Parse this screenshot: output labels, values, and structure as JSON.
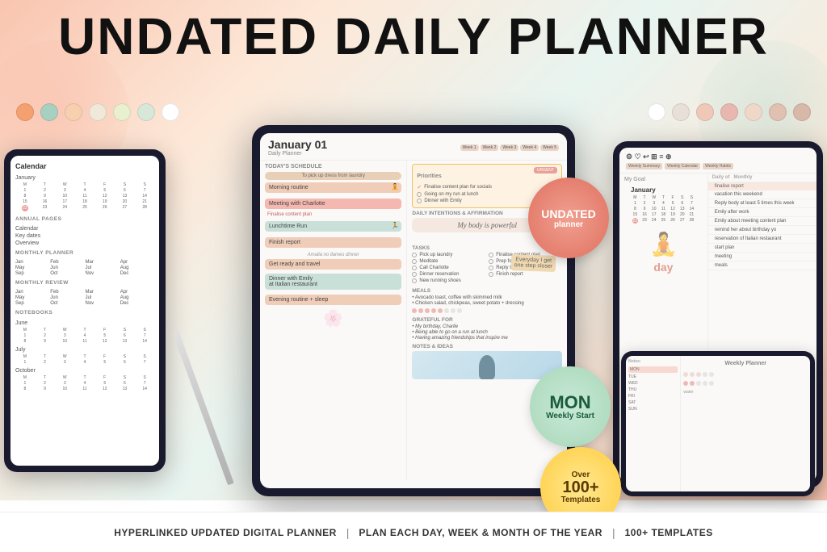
{
  "page": {
    "title": "UNDATED DAILY PLANNER",
    "subtitle": "HYPERLINKED UPDATED DIGITAL PLANNER | PLAN EACH DAY, WEEK & MONTH OF THE YEAR | 100+ TEMPLATES"
  },
  "colors": {
    "peach": "#f9c5b0",
    "teal_light": "#c8e0d8",
    "cream": "#faf9f7",
    "salmon": "#e8a098",
    "gold": "#ffcc40",
    "green_badge": "#a8d8b8",
    "dark_tablet": "#1a1a2e",
    "accent_pink": "#f4b8b0",
    "accent_peach": "#f0cdb8"
  },
  "dots_left": [
    "#f4a070",
    "#a8d0c0",
    "#f8d0b0",
    "#f0e8d8",
    "#e8f0d0",
    "#d8e8d8",
    "#fff"
  ],
  "dots_right": [
    "#fff",
    "#e8e0d8",
    "#f0c8b8",
    "#e8b8b0",
    "#f0d8c8",
    "#e0c0b0",
    "#d8b8a8"
  ],
  "center_tablet": {
    "date": "January 01",
    "subtitle": "Daily Planner",
    "week_buttons": [
      "Week 1",
      "Week 2",
      "Week 3",
      "Week 4",
      "Week 5"
    ],
    "schedule": {
      "label": "Today's Schedule",
      "items": [
        {
          "text": "Morning routine",
          "style": "peach"
        },
        {
          "text": "Meeting with Charlotte",
          "style": "pink"
        },
        {
          "text": "Finalise content plan",
          "sub": true
        },
        {
          "text": "Lunchtime Run",
          "style": "teal"
        },
        {
          "text": "Finish report",
          "style": "peach"
        },
        {
          "text": "Amalia no llames dinner",
          "note": true
        },
        {
          "text": "Get ready and travel",
          "style": "peach"
        },
        {
          "text": "Dinner with Emily at Italian restaurant",
          "style": "teal"
        },
        {
          "text": "Evening routine + sleep",
          "style": "peach"
        }
      ]
    },
    "priorities": {
      "label": "Priorities",
      "urgent_badge": "URGENT",
      "items": [
        "Finalise content plan for socials",
        "Going on my run at lunch",
        "Dinner with Emily"
      ]
    },
    "intentions": {
      "label": "Daily Intentions & Affirmation",
      "text": "My body is powerful",
      "sticky": "Everyday I get one step closer"
    },
    "tasks": {
      "label": "Tasks",
      "left": [
        "Pick up laundry",
        "Meditate",
        "Call Charlotte",
        "Dinner reservation",
        "New running shoes"
      ],
      "right": [
        "Finalise content plan",
        "Prep for meeting",
        "Reply to emails",
        "Finish report"
      ]
    },
    "meals": {
      "label": "Meals",
      "items": [
        "Avocado toast, coffee with skimmed milk",
        "Chicken salad, chickpeas, sweet potato + dressing"
      ],
      "tracker": [
        true,
        true,
        true,
        true,
        true,
        false,
        false,
        false
      ]
    },
    "grateful": {
      "label": "Grateful for",
      "items": [
        "My birthday, Charlie",
        "Being able to go on a run at lunch",
        "Having amazing friendships that inspire me"
      ]
    },
    "notes": {
      "label": "Notes & Ideas"
    }
  },
  "left_tablet": {
    "header": "Calendar",
    "annual_section": "ANNUAL PAGES",
    "annual_links": [
      "Calendar",
      "Key dates",
      "Overview"
    ],
    "monthly_section": "MONTHLY PLANNER",
    "monthly_grid": [
      [
        "Jan",
        "Feb",
        "Mar",
        "Apr"
      ],
      [
        "May",
        "Jun",
        "Jul",
        "Aug"
      ],
      [
        "Sep",
        "Oct",
        "Nov",
        "Dec"
      ]
    ],
    "review_section": "MONTHLY REVIEW",
    "review_grid": [
      [
        "Jan",
        "Feb",
        "Mar",
        "Apr"
      ],
      [
        "May",
        "Jun",
        "Jul",
        "Aug"
      ],
      [
        "Sep",
        "Oct",
        "Nov",
        "Dec"
      ]
    ],
    "notebooks_section": "NOTEBOOKS",
    "mini_calendars": [
      "January",
      "June",
      "July",
      "October"
    ]
  },
  "right_tablet": {
    "nav_tabs": [
      "Weekly Summary",
      "Weekly Calendar",
      "Weekly Habits"
    ],
    "goal_label": "My Goal",
    "month": "January",
    "task_rows": [
      "finalise report",
      "vacation this weekend",
      "Reply body at least 5 times this week",
      "Emily after work",
      "Emily about meeting content plan",
      "remind her about birthday yo",
      "reservation of Italian restaurant",
      "start plan",
      "meeting",
      "meals"
    ]
  },
  "bottom_tablet": {
    "sections": [
      "Daily",
      "Weekly",
      "Monthly"
    ],
    "label": "Weekly Planner"
  },
  "badges": {
    "undated": {
      "line1": "UNDATED",
      "line2": "planner"
    },
    "mon": {
      "main": "MON",
      "sub": "Weekly Start"
    },
    "templates": {
      "num": "100+",
      "label": "Templates"
    }
  },
  "bottom_bar": {
    "segments": [
      "HYPERLINKED UPDATED DIGITAL PLANNER",
      "PLAN EACH DAY, WEEK & MONTH OF THE YEAR",
      "100+ TEMPLATES"
    ],
    "separator": "|"
  }
}
